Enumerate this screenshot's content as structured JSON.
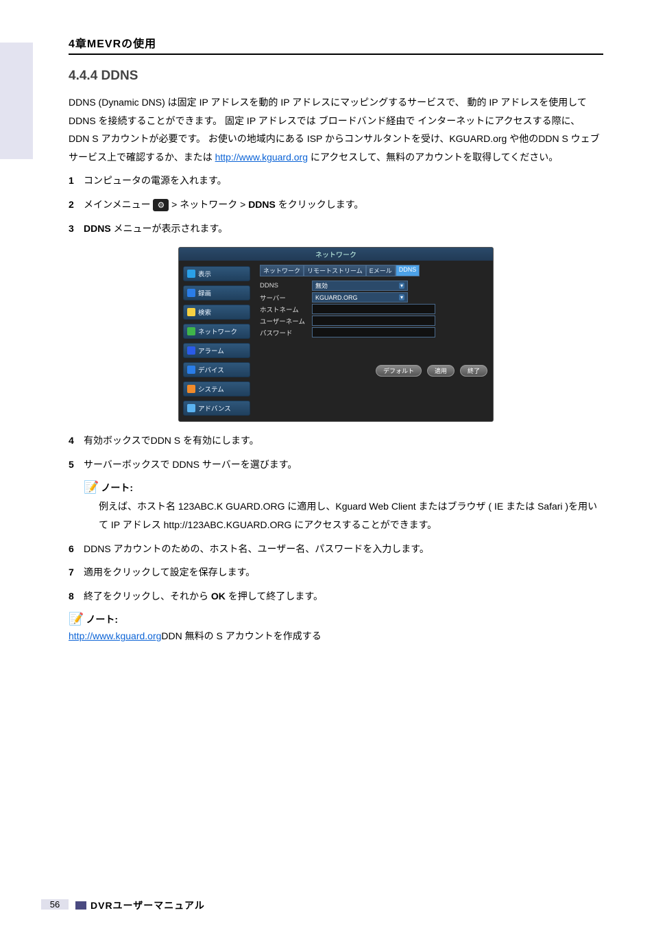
{
  "chapter_header": "4章MEVRの使用",
  "section_title": "4.4.4 DDNS",
  "intro": "DDNS (Dynamic DNS) は固定 IP アドレスを動的 IP アドレスにマッピングするサービスで、 動的 IP アドレスを使用して DDNS を接続することができます。 固定 IP アドレスでは ブロードバンド経由で インターネットにアクセスする際に、 DDN S アカウントが必要です。 お使いの地域内にある ISP からコンサルタントを受け、KGUARD.org や他のDDN S ウェブサービス上で確認するか、または http://www.kguard.org にアクセスして、無料のアカウントを取得してください。\n",
  "link_kguard": "http://www.kguard.org",
  "steps": {
    "s1": {
      "num": "1",
      "text": "コンピュータの電源を入れます。"
    },
    "s2": {
      "num": "2",
      "pre": "メインメニュー",
      "post_icon": ">",
      "mid": "ネットワーク >",
      "bold": "DDNS",
      "tail": "をクリックします。"
    },
    "s3": {
      "num": "3",
      "bold": "DDNS",
      "tail": " メニューが表示されます。"
    },
    "s4": {
      "num": "4",
      "text": "有効ボックスでDDN S を有効にします。"
    },
    "s5": {
      "num": "5",
      "text": "サーバーボックスで DDNS サーバーを選びます。"
    },
    "s6": {
      "num": "6",
      "text": "DDNS アカウントのための、ホスト名、ユーザー名、パスワードを入力します。"
    },
    "s7": {
      "num": "7",
      "text": "適用をクリックして設定を保存します。"
    },
    "s8": {
      "num": "8",
      "pre": "終了をクリックし、それから ",
      "bold": "OK",
      "tail": " を押して終了します。"
    }
  },
  "note1": {
    "label": "ノート:",
    "line1": "例えば、ホスト名 123ABC.K GUARD.ORG に適用し、Kguard Web Client またはブラウザ ( IE または Safari )を用いて IP アドレス http://123ABC.KGUARD.ORG にアクセスすることができます。"
  },
  "note2": {
    "label": "ノート:",
    "link": "http://www.kguard.org",
    "tail": "DDN 無料の S アカウントを作成する"
  },
  "shot": {
    "title": "ネットワーク",
    "side": [
      "表示",
      "録画",
      "検索",
      "ネットワーク",
      "アラーム",
      "デバイス",
      "システム",
      "アドバンス"
    ],
    "tabs": [
      "ネットワーク",
      "リモートストリーム",
      "Eメール",
      "DDNS"
    ],
    "labels": {
      "ddns": "DDNS",
      "server": "サーバー",
      "host": "ホストネーム",
      "user": "ユーザーネーム",
      "pass": "パスワード"
    },
    "vals": {
      "ddns": "無効",
      "server": "KGUARD.ORG"
    },
    "btns": {
      "def": "デフォルト",
      "apply": "適用",
      "exit": "終了"
    }
  },
  "footer": {
    "text": "DVRユーザーマニュアル",
    "page": "56"
  }
}
